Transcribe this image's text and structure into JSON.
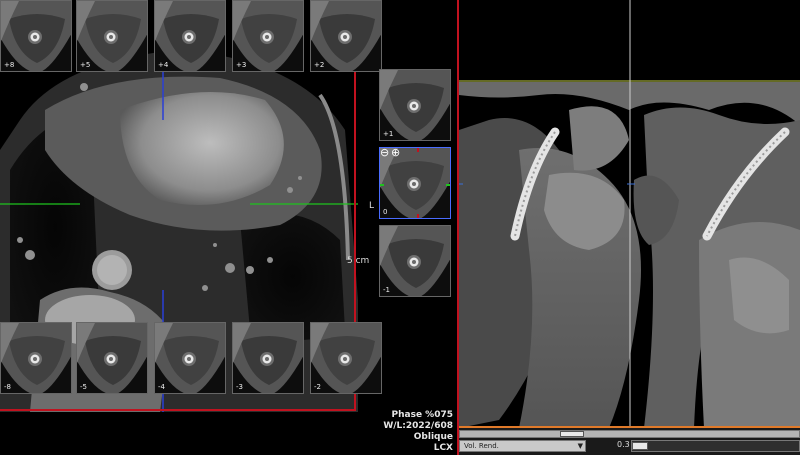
{
  "thumbs_top": [
    "+8",
    "+5",
    "+4",
    "+3",
    "+2"
  ],
  "thumbs_right": [
    "+1",
    "0",
    "-1"
  ],
  "thumbs_bottom": [
    "-8",
    "-5",
    "-4",
    "-3",
    "-2"
  ],
  "left_view": {
    "orientation_label": "L",
    "scale_label": "5 cm"
  },
  "focus_controls": {
    "zoom_out_symbol": "⊖",
    "zoom_in_symbol": "⊕"
  },
  "info": {
    "phase": "Phase %075",
    "window_level": "W/L:2022/608",
    "plane": "Oblique",
    "vessel": "LCX"
  },
  "statusbar": {
    "render_mode": "Vol. Rend.",
    "slab_value": "0.3"
  },
  "colors": {
    "frame_red": "#c1121f",
    "crosshair_green": "#1ec41e",
    "crosshair_blue": "#2a3fd6",
    "ref_line_yellow": "#c9d44a"
  }
}
